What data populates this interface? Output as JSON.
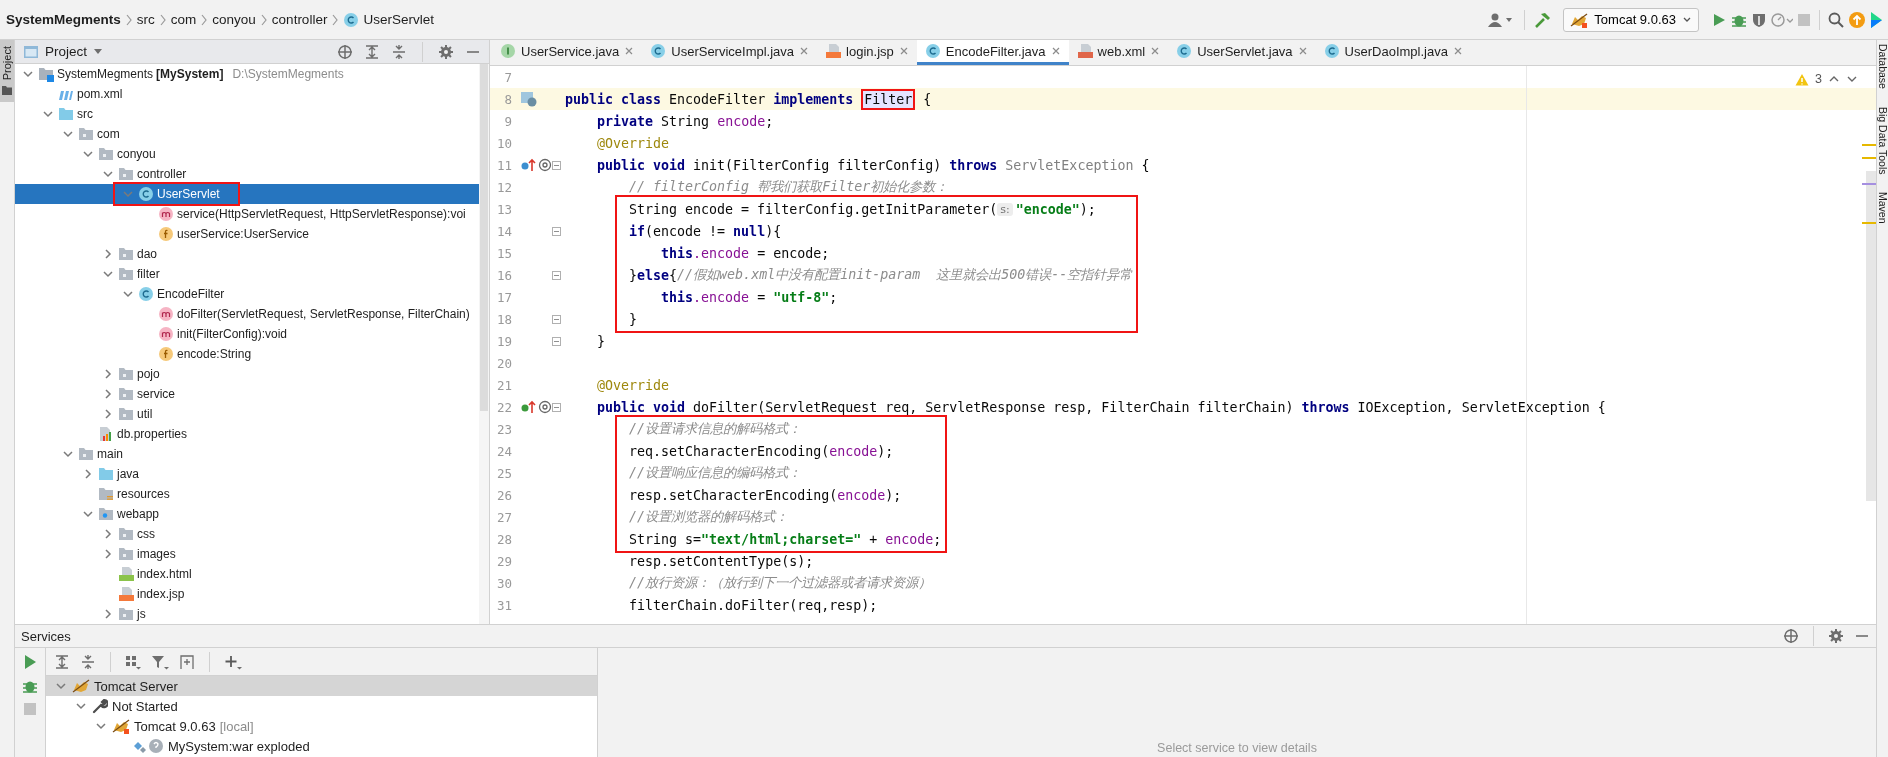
{
  "breadcrumbs": [
    {
      "label": "SystemMegments",
      "kind": "project"
    },
    {
      "label": "src",
      "kind": "folder"
    },
    {
      "label": "com",
      "kind": "folder"
    },
    {
      "label": "conyou",
      "kind": "folder"
    },
    {
      "label": "controller",
      "kind": "folder"
    },
    {
      "label": "UserServlet",
      "kind": "class"
    }
  ],
  "run_config": {
    "label": "Tomcat 9.0.63"
  },
  "left_stripe": [
    {
      "label": "Project",
      "selected": true
    }
  ],
  "project_panel": {
    "title": "Project",
    "tree": [
      {
        "label": "SystemMegments **[MySystem]**",
        "path": "D:\\SystemMegments",
        "kind": "module",
        "expanded": true,
        "selected": false,
        "boxed": false,
        "children": [
          {
            "label": "pom.xml",
            "kind": "maven",
            "selected": false,
            "boxed": false
          },
          {
            "label": "src",
            "kind": "source-folder",
            "expanded": true,
            "selected": false,
            "boxed": false,
            "children": [
              {
                "label": "com",
                "kind": "package",
                "expanded": true,
                "selected": false,
                "boxed": false,
                "children": [
                  {
                    "label": "conyou",
                    "kind": "package",
                    "expanded": true,
                    "selected": false,
                    "boxed": false,
                    "children": [
                      {
                        "label": "controller",
                        "kind": "package",
                        "expanded": true,
                        "selected": false,
                        "boxed": false,
                        "children": [
                          {
                            "label": "UserServlet",
                            "kind": "class",
                            "expanded": true,
                            "selected": true,
                            "boxed": true,
                            "children": [
                              {
                                "label": "service(HttpServletRequest, HttpServletResponse):voi",
                                "kind": "method",
                                "selected": false,
                                "boxed": false
                              },
                              {
                                "label": "userService:UserService",
                                "kind": "field",
                                "selected": false,
                                "boxed": false
                              }
                            ]
                          }
                        ]
                      },
                      {
                        "label": "dao",
                        "kind": "package",
                        "expanded": false,
                        "selected": false,
                        "boxed": false
                      },
                      {
                        "label": "filter",
                        "kind": "package",
                        "expanded": true,
                        "selected": false,
                        "boxed": false,
                        "children": [
                          {
                            "label": "EncodeFilter",
                            "kind": "class",
                            "expanded": true,
                            "selected": false,
                            "boxed": false,
                            "children": [
                              {
                                "label": "doFilter(ServletRequest, ServletResponse, FilterChain)",
                                "kind": "method",
                                "selected": false,
                                "boxed": false
                              },
                              {
                                "label": "init(FilterConfig):void",
                                "kind": "method",
                                "selected": false,
                                "boxed": false
                              },
                              {
                                "label": "encode:String",
                                "kind": "field",
                                "selected": false,
                                "boxed": false
                              }
                            ]
                          }
                        ]
                      },
                      {
                        "label": "pojo",
                        "kind": "package",
                        "expanded": false,
                        "selected": false,
                        "boxed": false
                      },
                      {
                        "label": "service",
                        "kind": "package",
                        "expanded": false,
                        "selected": false,
                        "boxed": false
                      },
                      {
                        "label": "util",
                        "kind": "package",
                        "expanded": false,
                        "selected": false,
                        "boxed": false
                      }
                    ]
                  },
                  {
                    "label": "db.properties",
                    "kind": "properties",
                    "selected": false,
                    "boxed": false
                  }
                ]
              },
              {
                "label": "main",
                "kind": "package",
                "expanded": true,
                "selected": false,
                "boxed": false,
                "children": [
                  {
                    "label": "java",
                    "kind": "source-folder",
                    "expanded": false,
                    "selected": false,
                    "boxed": false
                  },
                  {
                    "label": "resources",
                    "kind": "resources",
                    "selected": false,
                    "boxed": false
                  },
                  {
                    "label": "webapp",
                    "kind": "web-folder",
                    "expanded": true,
                    "selected": false,
                    "boxed": false,
                    "children": [
                      {
                        "label": "css",
                        "kind": "package",
                        "expanded": false,
                        "selected": false,
                        "boxed": false
                      },
                      {
                        "label": "images",
                        "kind": "package",
                        "expanded": false,
                        "selected": false,
                        "boxed": false
                      },
                      {
                        "label": "index.html",
                        "kind": "html",
                        "selected": false,
                        "boxed": false
                      },
                      {
                        "label": "index.jsp",
                        "kind": "jsp",
                        "selected": false,
                        "boxed": false
                      },
                      {
                        "label": "js",
                        "kind": "package",
                        "expanded": false,
                        "selected": false,
                        "boxed": false
                      }
                    ]
                  }
                ]
              }
            ]
          }
        ]
      }
    ]
  },
  "editor": {
    "tabs": [
      {
        "label": "UserService.java",
        "kind": "interface",
        "selected": false
      },
      {
        "label": "UserServiceImpl.java",
        "kind": "class",
        "selected": false
      },
      {
        "label": "login.jsp",
        "kind": "jsp",
        "selected": false
      },
      {
        "label": "EncodeFilter.java",
        "kind": "class",
        "selected": true
      },
      {
        "label": "web.xml",
        "kind": "xml",
        "selected": false
      },
      {
        "label": "UserServlet.java",
        "kind": "class",
        "selected": false
      },
      {
        "label": "UserDaoImpl.java",
        "kind": "class",
        "selected": false
      }
    ],
    "warnings": "3",
    "code_lines": [
      {
        "number": "7"
      },
      {
        "number": "8",
        "gutter": {
          "kind": "web"
        },
        "current": true,
        "tokens": [
          {
            "kind": "kw",
            "text": "public class "
          },
          {
            "kind": "plain",
            "text": "EncodeFilter "
          },
          {
            "kind": "kw",
            "text": "implements "
          },
          {
            "kind": "ident",
            "text": "Filter",
            "boxed": true
          },
          {
            "kind": "plain",
            "text": " {"
          }
        ]
      },
      {
        "number": "9",
        "tokens": [
          {
            "kind": "kw",
            "text": "    private "
          },
          {
            "kind": "plain",
            "text": "String "
          },
          {
            "kind": "field",
            "text": "encode"
          },
          {
            "kind": "plain",
            "text": ";"
          }
        ]
      },
      {
        "number": "10",
        "tokens": [
          {
            "kind": "annot",
            "text": "    @Override"
          }
        ]
      },
      {
        "number": "11",
        "gutter": {
          "kind": "overrides"
        },
        "fold": true,
        "tokens": [
          {
            "kind": "kw",
            "text": "    public void "
          },
          {
            "kind": "plain",
            "text": "init(FilterConfig filterConfig) "
          },
          {
            "kind": "kw",
            "text": "throws "
          },
          {
            "kind": "unused",
            "text": "ServletException"
          },
          {
            "kind": "plain",
            "text": " {"
          }
        ]
      },
      {
        "number": "12",
        "tokens": [
          {
            "kind": "comment",
            "text": "        // filterConfig 帮我们获取Filter初始化参数："
          }
        ]
      },
      {
        "number": "13",
        "boxed": true,
        "tokens": [
          {
            "kind": "plain",
            "text": "        String encode = filterConfig.getInitParameter("
          },
          {
            "kind": "hint",
            "text": "s:"
          },
          {
            "kind": "str",
            "text": "\"encode\""
          },
          {
            "kind": "plain",
            "text": ");"
          }
        ]
      },
      {
        "number": "14",
        "boxed": true,
        "fold": true,
        "tokens": [
          {
            "kind": "kw",
            "text": "        if"
          },
          {
            "kind": "plain",
            "text": "(encode != "
          },
          {
            "kind": "kw",
            "text": "null"
          },
          {
            "kind": "plain",
            "text": "){"
          }
        ]
      },
      {
        "number": "15",
        "boxed": true,
        "tokens": [
          {
            "kind": "kw",
            "text": "            this"
          },
          {
            "kind": "field",
            "text": ".encode"
          },
          {
            "kind": "plain",
            "text": " = encode;"
          }
        ]
      },
      {
        "number": "16",
        "boxed": true,
        "fold": true,
        "tokens": [
          {
            "kind": "plain",
            "text": "        }"
          },
          {
            "kind": "kw",
            "text": "else"
          },
          {
            "kind": "plain",
            "text": "{"
          },
          {
            "kind": "comment",
            "text": "//假如web.xml中没有配置init-param  这里就会出500错误--空指针异常"
          }
        ]
      },
      {
        "number": "17",
        "boxed": true,
        "tokens": [
          {
            "kind": "kw",
            "text": "            this"
          },
          {
            "kind": "field",
            "text": ".encode"
          },
          {
            "kind": "plain",
            "text": " = "
          },
          {
            "kind": "str",
            "text": "\"utf-8\""
          },
          {
            "kind": "plain",
            "text": ";"
          }
        ]
      },
      {
        "number": "18",
        "boxed": true,
        "fold": true,
        "tokens": [
          {
            "kind": "plain",
            "text": "        }"
          }
        ]
      },
      {
        "number": "19",
        "fold": true,
        "tokens": [
          {
            "kind": "plain",
            "text": "    }"
          }
        ]
      },
      {
        "number": "20"
      },
      {
        "number": "21",
        "tokens": [
          {
            "kind": "annot",
            "text": "    @Override"
          }
        ]
      },
      {
        "number": "22",
        "gutter": {
          "kind": "implements"
        },
        "fold": true,
        "tokens": [
          {
            "kind": "kw",
            "text": "    public void "
          },
          {
            "kind": "plain",
            "text": "doFilter(ServletRequest req, ServletResponse resp, FilterChain filterChain) "
          },
          {
            "kind": "kw",
            "text": "throws "
          },
          {
            "kind": "plain",
            "text": "IOException, ServletException {"
          }
        ]
      },
      {
        "number": "23",
        "boxed": true,
        "tokens": [
          {
            "kind": "comment",
            "text": "        //设置请求信息的解码格式："
          }
        ]
      },
      {
        "number": "24",
        "boxed": true,
        "tokens": [
          {
            "kind": "plain",
            "text": "        req.setCharacterEncoding("
          },
          {
            "kind": "field",
            "text": "encode"
          },
          {
            "kind": "plain",
            "text": ");"
          }
        ]
      },
      {
        "number": "25",
        "boxed": true,
        "tokens": [
          {
            "kind": "comment",
            "text": "        //设置响应信息的编码格式："
          }
        ]
      },
      {
        "number": "26",
        "boxed": true,
        "tokens": [
          {
            "kind": "plain",
            "text": "        resp.setCharacterEncoding("
          },
          {
            "kind": "field",
            "text": "encode"
          },
          {
            "kind": "plain",
            "text": ");"
          }
        ]
      },
      {
        "number": "27",
        "boxed": true,
        "tokens": [
          {
            "kind": "comment",
            "text": "        //设置浏览器的解码格式："
          }
        ]
      },
      {
        "number": "28",
        "boxed": true,
        "tokens": [
          {
            "kind": "plain",
            "text": "        String s="
          },
          {
            "kind": "str",
            "text": "\"text/html;charset=\""
          },
          {
            "kind": "plain",
            "text": " + "
          },
          {
            "kind": "field",
            "text": "encode"
          },
          {
            "kind": "plain",
            "text": ";"
          }
        ]
      },
      {
        "number": "29",
        "tokens": [
          {
            "kind": "plain",
            "text": "        resp.setContentType(s);"
          }
        ]
      },
      {
        "number": "30",
        "tokens": [
          {
            "kind": "comment",
            "text": "        //放行资源：（放行到下一个过滤器或者请求资源）"
          }
        ]
      },
      {
        "number": "31",
        "tokens": [
          {
            "kind": "plain",
            "text": "        filterChain.doFilter(req,resp);"
          }
        ]
      }
    ]
  },
  "right_stripe": [
    {
      "label": "Database",
      "selected": false
    },
    {
      "label": "Big Data Tools",
      "selected": false
    },
    {
      "label": "Maven",
      "selected": false
    }
  ],
  "services": {
    "title": "Services",
    "tree": [
      {
        "label": "Tomcat Server",
        "kind": "server",
        "expanded": true,
        "selected": true,
        "children": [
          {
            "label": "Not Started",
            "kind": "wrench",
            "expanded": true,
            "selected": false,
            "children": [
              {
                "label": "Tomcat 9.0.63",
                "detail": "[local]",
                "kind": "tomcat",
                "expanded": true,
                "selected": false,
                "children": [
                  {
                    "label": "MySystem:war exploded",
                    "kind": "artifact",
                    "selected": false
                  }
                ]
              }
            ]
          }
        ]
      }
    ],
    "empty_message": "Select service to view details"
  }
}
